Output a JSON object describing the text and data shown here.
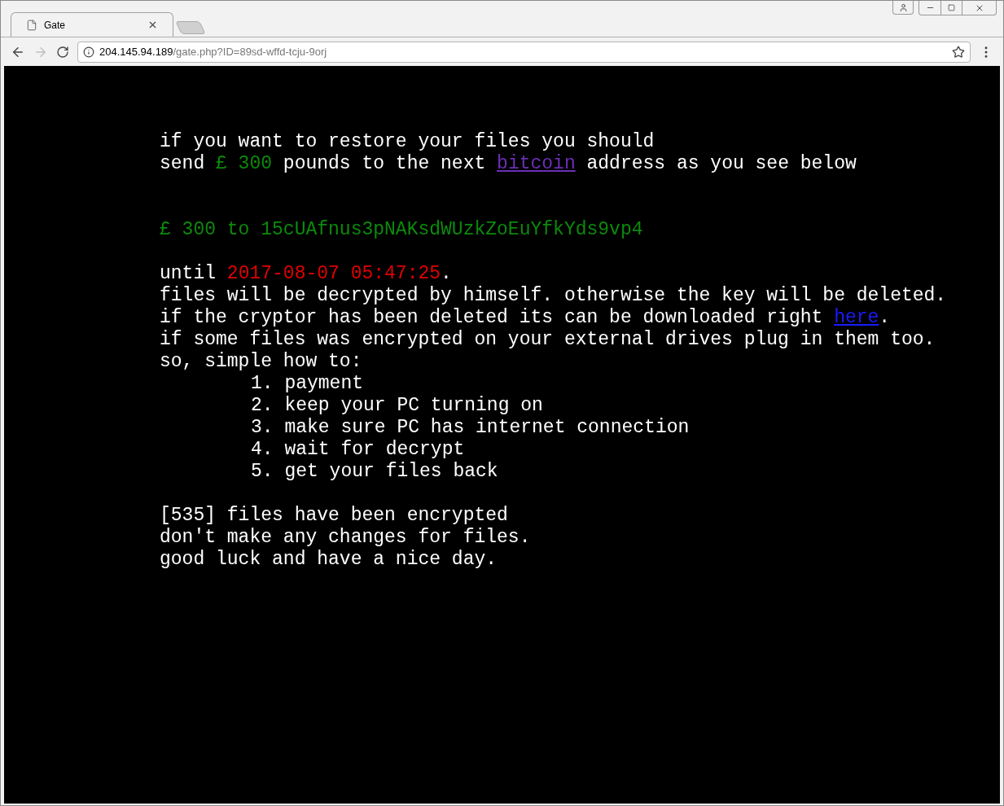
{
  "tab": {
    "title": "Gate",
    "selected": true
  },
  "address_bar": {
    "host": "204.145.94.189",
    "path": "/gate.php?ID=89sd-wffd-tcju-9orj"
  },
  "nav": {
    "back_disabled": false,
    "forward_disabled": true
  },
  "note": {
    "intro": [
      [
        {
          "kind": "text",
          "text": "if you want to restore your files you should"
        }
      ],
      [
        {
          "kind": "text",
          "text": "send "
        },
        {
          "kind": "green",
          "text": "£ 300"
        },
        {
          "kind": "text",
          "text": " pounds to the next "
        },
        {
          "kind": "link",
          "text": "bitcoin",
          "visited": true
        },
        {
          "kind": "text",
          "text": " address as you see below"
        }
      ]
    ],
    "address": [
      [
        {
          "kind": "green",
          "text": "£ 300 to 15cUAfnus3pNAKsdWUzkZoEuYfkYds9vp4"
        }
      ]
    ],
    "instructions": [
      [
        {
          "kind": "text",
          "text": "until "
        },
        {
          "kind": "red",
          "text": "2017-08-07 05:47:25"
        },
        {
          "kind": "text",
          "text": "."
        }
      ],
      [
        {
          "kind": "text",
          "text": "files will be decrypted by himself. otherwise the key will be deleted."
        }
      ],
      [
        {
          "kind": "text",
          "text": "if the cryptor has been deleted its can be downloaded right "
        },
        {
          "kind": "link",
          "text": "here",
          "visited": false
        },
        {
          "kind": "text",
          "text": "."
        }
      ],
      [
        {
          "kind": "text",
          "text": "if some files was encrypted on your external drives plug in them too."
        }
      ],
      [
        {
          "kind": "text",
          "text": "so, simple how to:"
        }
      ]
    ],
    "steps": [
      "1. payment",
      "2. keep your PC turning on",
      "3. make sure PC has internet connection",
      "4. wait for decrypt",
      "5. get your files back"
    ],
    "closing": [
      [
        {
          "kind": "text",
          "text": "[535] files have been encrypted"
        }
      ],
      [
        {
          "kind": "text",
          "text": "don't make any changes for files."
        }
      ],
      [
        {
          "kind": "text",
          "text": "good luck and have a nice day."
        }
      ]
    ]
  }
}
